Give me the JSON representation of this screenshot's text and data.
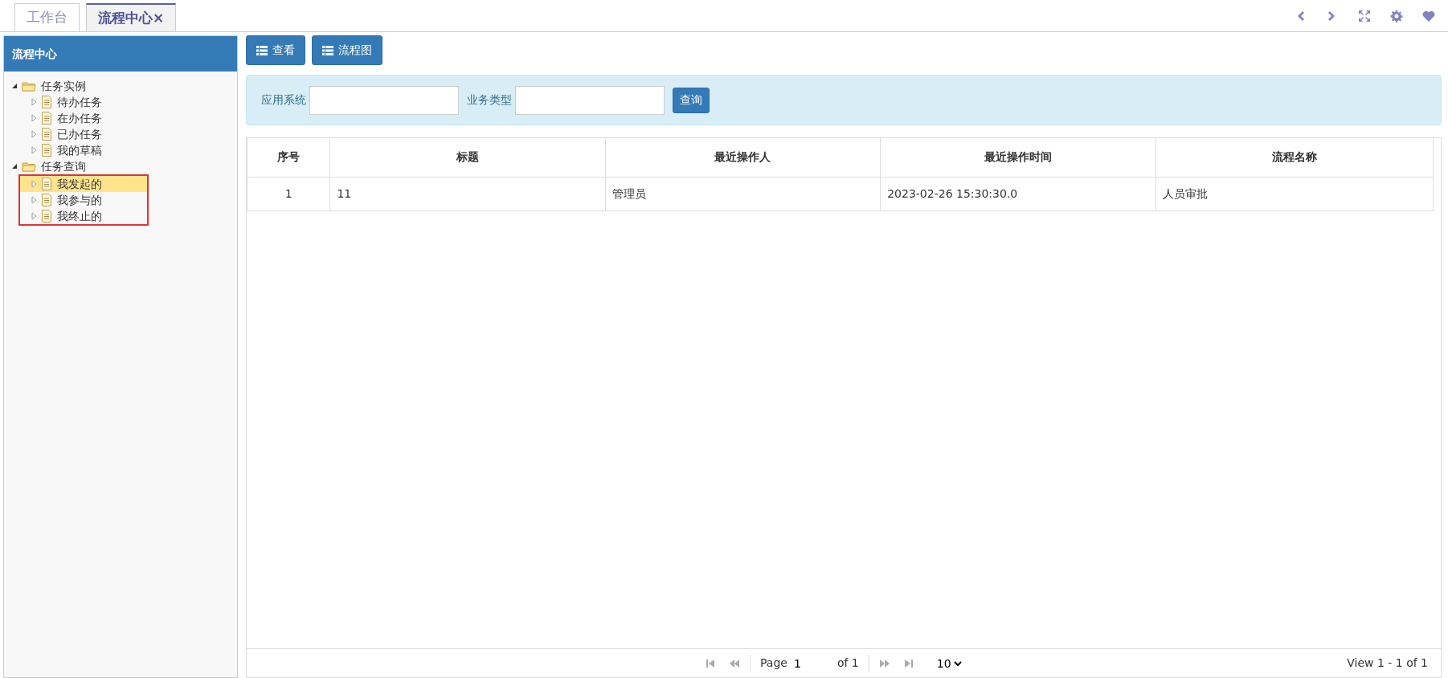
{
  "tabs": [
    {
      "label": "工作台",
      "selected": false
    },
    {
      "label": "流程中心",
      "selected": true,
      "close": "×"
    }
  ],
  "sidebar": {
    "title": "流程中心",
    "tree": [
      {
        "label": "任务实例",
        "expanded": true,
        "outlined": false,
        "children": [
          {
            "label": "待办任务",
            "selected": false
          },
          {
            "label": "在办任务",
            "selected": false
          },
          {
            "label": "已办任务",
            "selected": false
          },
          {
            "label": "我的草稿",
            "selected": false
          }
        ]
      },
      {
        "label": "任务查询",
        "expanded": true,
        "outlined": true,
        "children": [
          {
            "label": "我发起的",
            "selected": true
          },
          {
            "label": "我参与的",
            "selected": false
          },
          {
            "label": "我终止的",
            "selected": false
          }
        ]
      }
    ]
  },
  "toolbar": [
    "查看",
    "流程图"
  ],
  "search": {
    "fields": [
      {
        "label": "应用系统"
      },
      {
        "label": "业务类型"
      }
    ],
    "button": "查询"
  },
  "table": {
    "columns": [
      "序号",
      "标题",
      "最近操作人",
      "最近操作时间",
      "流程名称"
    ],
    "rows": [
      [
        "1",
        "11",
        "管理员",
        "2023-02-26 15:30:30.0",
        "人员审批"
      ]
    ]
  },
  "pager": {
    "page_label": "Page",
    "page": "1",
    "of": "of 1",
    "page_size": "10",
    "view": "View 1 - 1 of 1"
  }
}
